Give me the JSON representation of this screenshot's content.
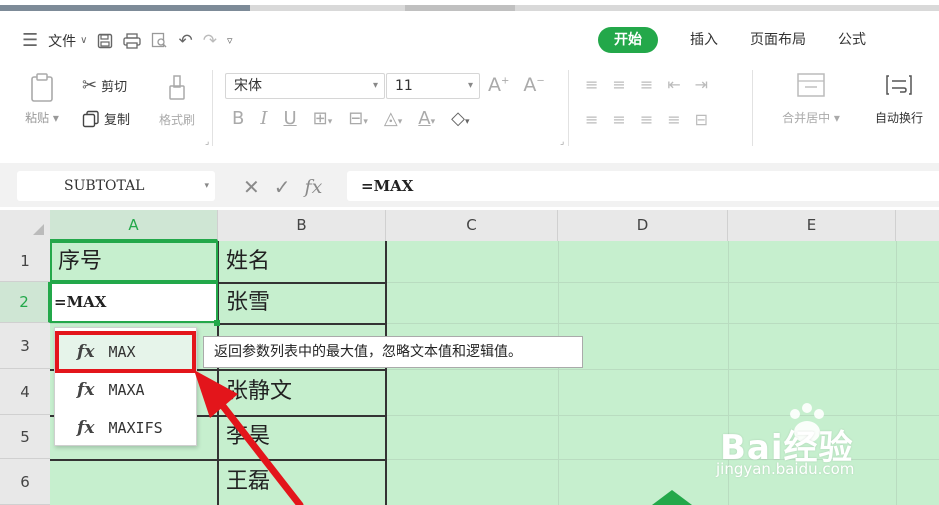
{
  "menubar": {
    "file_label": "文件",
    "tabs": [
      {
        "label": "开始",
        "active": true
      },
      {
        "label": "插入",
        "active": false
      },
      {
        "label": "页面布局",
        "active": false
      },
      {
        "label": "公式",
        "active": false
      }
    ]
  },
  "ribbon": {
    "paste_label": "粘贴",
    "cut_label": "剪切",
    "copy_label": "复制",
    "format_painter_label": "格式刷",
    "font_name": "宋体",
    "font_size": "11",
    "merge_label": "合并居中",
    "wrap_label": "自动换行",
    "bold_label": "B",
    "italic_label": "I",
    "underline_label": "U",
    "font_color_label": "A"
  },
  "formula_bar": {
    "name_box": "SUBTOTAL",
    "fx_label": "fx",
    "content": "=MAX"
  },
  "sheet": {
    "columns": [
      "A",
      "B",
      "C",
      "D",
      "E"
    ],
    "rows": [
      "1",
      "2",
      "3",
      "4",
      "5",
      "6"
    ],
    "cells": {
      "A1": "序号",
      "B1": "姓名",
      "A2": "=MAX",
      "B2": "张雪",
      "B4": "张静文",
      "B5": "李昊",
      "B6": "王磊"
    }
  },
  "autocomplete": {
    "items": [
      {
        "fx": "fx",
        "name": "MAX"
      },
      {
        "fx": "fx",
        "name": "MAXA"
      },
      {
        "fx": "fx",
        "name": "MAXIFS"
      }
    ],
    "tooltip": "返回参数列表中的最大值，忽略文本值和逻辑值。"
  },
  "watermark": {
    "brand": "Bai经验",
    "url": "jingyan.baidu.com"
  },
  "colors": {
    "accent_green": "#23a84a",
    "grid_fill": "#c6efce",
    "highlight_red": "#e3151b"
  }
}
